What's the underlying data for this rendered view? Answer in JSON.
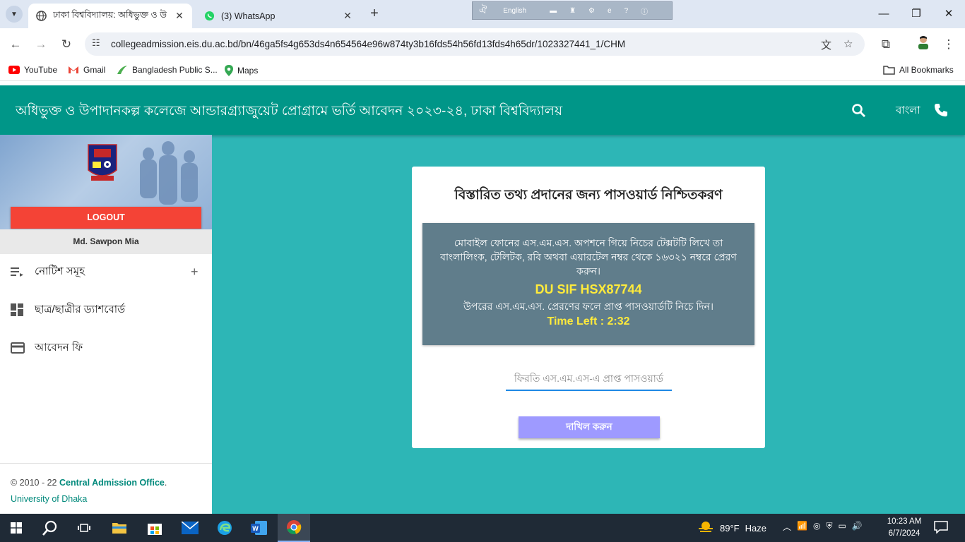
{
  "browser": {
    "tabs": [
      {
        "title": "ঢাকা বিশ্ববিদ্যালয়: অধিভুক্ত ও উ",
        "active": true
      },
      {
        "title": "(3) WhatsApp",
        "active": false
      }
    ],
    "ime_language": "English",
    "url": "collegeadmission.eis.du.ac.bd/bn/46ga5fs4g653ds4n654564e96w874ty3b16fds54h56fd13fds4h65dr/1023327441_1/CHM",
    "bookmarks": [
      "YouTube",
      "Gmail",
      "Bangladesh Public S...",
      "Maps"
    ],
    "all_bookmarks": "All Bookmarks"
  },
  "header": {
    "title": "অধিভুক্ত ও উপাদানকল্প কলেজে আন্ডারগ্র্যাজুয়েট প্রোগ্রামে ভর্তি আবেদন ২০২৩-২৪, ঢাকা বিশ্ববিদ্যালয়",
    "language_label": "বাংলা"
  },
  "sidebar": {
    "logout_label": "LOGOUT",
    "user_name": "Md. Sawpon Mia",
    "menu": [
      {
        "label": "নোটিশ সমূহ",
        "icon": "notice-list-icon",
        "expandable": true
      },
      {
        "label": "ছাত্র/ছাত্রীর ড্যাশবোর্ড",
        "icon": "dashboard-icon",
        "expandable": false
      },
      {
        "label": "আবেদন ফি",
        "icon": "credit-card-icon",
        "expandable": false
      }
    ],
    "footer": {
      "copyright": "© 2010 - 22",
      "office": "Central Admission Office",
      "period": ".",
      "university": "University of Dhaka"
    }
  },
  "card": {
    "title": "বিস্তারিত তথ্য প্রদানের জন্য পাসওয়ার্ড নিশ্চিতকরণ",
    "instruction": "মোবাইল ফোনের এস.এম.এস. অপশনে গিয়ে নিচের টেক্সটটি লিখে তা বাংলালিংক, টেলিটক, রবি অথবা এয়ারটেল নম্বর থেকে ১৬৩২১ নম্বরে প্রেরণ করুন।",
    "sms_code": "DU SIF HSX87744",
    "after_text": "উপরের এস.এম.এস. প্রেরণের ফলে প্রাপ্ত পাসওয়ার্ডটি নিচে দিন।",
    "time_left": "Time Left : 2:32",
    "input_placeholder": "ফিরতি এস.এম.এস-এ প্রাপ্ত পাসওয়ার্ড",
    "input_value": "",
    "submit_label": "দাখিল করুন"
  },
  "taskbar": {
    "weather_temp": "89°F",
    "weather_desc": "Haze",
    "time": "10:23 AM",
    "date": "6/7/2024"
  },
  "colors": {
    "header": "#009688",
    "page_bg": "#2db6b6",
    "logout": "#f44336",
    "info_box": "#607d8b",
    "highlight": "#ffeb3b",
    "submit": "#9e9aff"
  }
}
